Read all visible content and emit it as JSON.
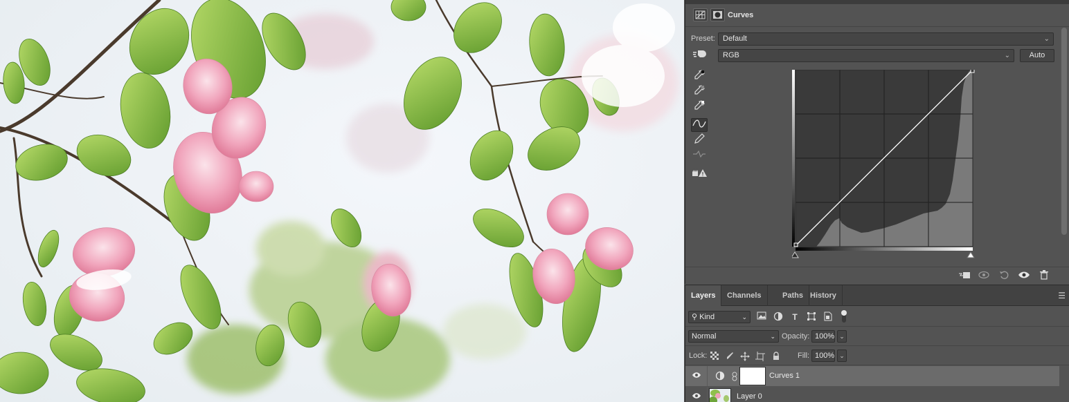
{
  "canvas": {
    "description_icon": "photo-canvas"
  },
  "properties": {
    "title": "Curves",
    "preset_label": "Preset:",
    "preset_value": "Default",
    "channel_value": "RGB",
    "auto_label": "Auto",
    "tools": [
      "target-adjust-icon",
      "black-point-eyedropper-icon",
      "gray-point-eyedropper-icon",
      "white-point-eyedropper-icon",
      "curve-points-icon",
      "pencil-icon",
      "smooth-icon",
      "clipping-warning-icon"
    ],
    "footer_icons": [
      "clip-to-layer-icon",
      "view-previous-icon",
      "reset-icon",
      "visibility-icon",
      "delete-icon"
    ]
  },
  "layers_panel": {
    "tabs": [
      {
        "label": "Layers",
        "active": true
      },
      {
        "label": "Channels",
        "active": false
      },
      {
        "label": "Paths",
        "active": false
      },
      {
        "label": "History",
        "active": false
      }
    ],
    "filter_kind": "Kind",
    "blend_mode": "Normal",
    "opacity_label": "Opacity:",
    "opacity_value": "100%",
    "lock_label": "Lock:",
    "fill_label": "Fill:",
    "fill_value": "100%",
    "layers": [
      {
        "name": "Curves 1",
        "selected": true,
        "visible": true
      },
      {
        "name": "Layer 0",
        "selected": false,
        "visible": true
      }
    ]
  },
  "colors": {
    "panel_bg": "#535353",
    "selected_row": "#6b6b6b",
    "curve_line": "#ffffff",
    "histogram": "#7a7a7a"
  }
}
